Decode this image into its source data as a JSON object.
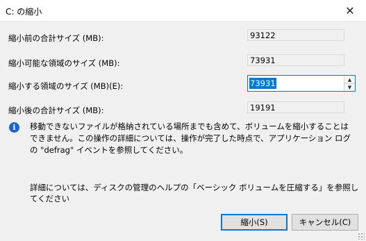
{
  "window": {
    "title": "C: の縮小",
    "close_glyph": "✕"
  },
  "fields": {
    "total_before": {
      "label": "縮小前の合計サイズ (MB):",
      "value": "93122"
    },
    "available": {
      "label": "縮小可能な領域のサイズ (MB):",
      "value": "73931"
    },
    "shrink_amount": {
      "label": "縮小する領域のサイズ (MB)(E):",
      "value": "73931"
    },
    "total_after": {
      "label": "縮小後の合計サイズ (MB):",
      "value": "19191"
    }
  },
  "info": {
    "icon": "i",
    "message": "移動できないファイルが格納されている場所までも含めて、ボリュームを縮小することはできません。この操作の詳細については、操作が完了した時点で、アプリケーション ログの \"defrag\" イベントを参照してください。",
    "help_text": "詳細については、ディスクの管理のヘルプの「ベーシック ボリュームを圧縮する」を参照してください"
  },
  "buttons": {
    "shrink": "縮小(S)",
    "cancel": "キャンセル(C)"
  },
  "colors": {
    "accent": "#0078d7",
    "info_icon": "#1c64c8",
    "background": "#f0f0f0"
  }
}
